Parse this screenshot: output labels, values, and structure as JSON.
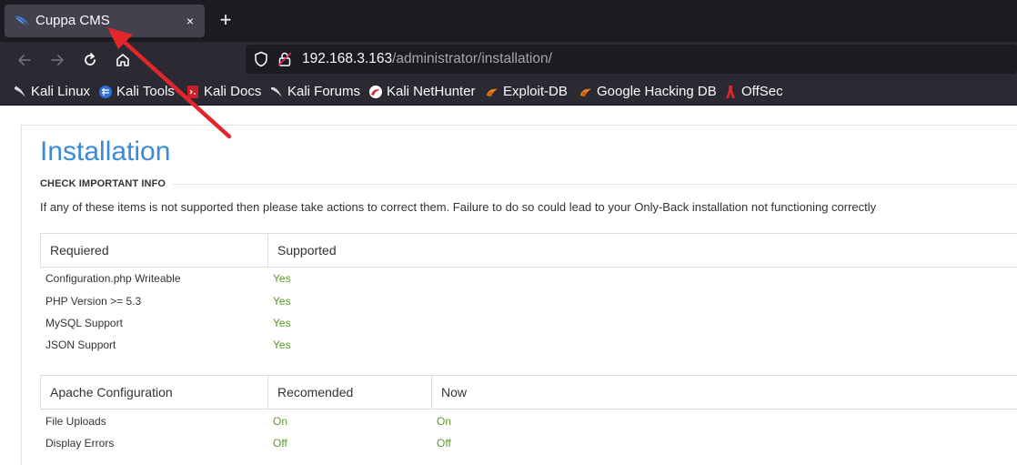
{
  "browser": {
    "tab_title": "Cuppa CMS",
    "tab_close": "×",
    "new_tab": "+",
    "url_host": "192.168.3.163",
    "url_path": "/administrator/installation/",
    "bookmarks": [
      {
        "label": "Kali Linux",
        "icon": "kali-dragon-icon"
      },
      {
        "label": "Kali Tools",
        "icon": "kali-tools-icon"
      },
      {
        "label": "Kali Docs",
        "icon": "kali-docs-icon"
      },
      {
        "label": "Kali Forums",
        "icon": "kali-forums-icon"
      },
      {
        "label": "Kali NetHunter",
        "icon": "nethunter-icon"
      },
      {
        "label": "Exploit-DB",
        "icon": "exploit-db-icon"
      },
      {
        "label": "Google Hacking DB",
        "icon": "ghdb-icon"
      },
      {
        "label": "OffSec",
        "icon": "offsec-icon"
      }
    ]
  },
  "page": {
    "title": "Installation",
    "section_label": "CHECK IMPORTANT INFO",
    "info_text": "If any of these items is not supported then please take actions to correct them. Failure to do so could lead to your Only-Back installation not functioning correctly",
    "requirements_table": {
      "headers": [
        "Requiered",
        "Supported"
      ],
      "rows": [
        {
          "label": "Configuration.php Writeable",
          "value": "Yes"
        },
        {
          "label": "PHP Version >= 5.3",
          "value": "Yes"
        },
        {
          "label": "MySQL Support",
          "value": "Yes"
        },
        {
          "label": "JSON Support",
          "value": "Yes"
        }
      ]
    },
    "apache_table": {
      "headers": [
        "Apache Configuration",
        "Recomended",
        "Now"
      ],
      "rows": [
        {
          "label": "File Uploads",
          "recommended": "On",
          "now": "On"
        },
        {
          "label": "Display Errors",
          "recommended": "Off",
          "now": "Off"
        }
      ]
    }
  },
  "colors": {
    "title_blue": "#3a8ad6",
    "value_green": "#5c9a2c",
    "annotation_red": "#e3262b"
  }
}
